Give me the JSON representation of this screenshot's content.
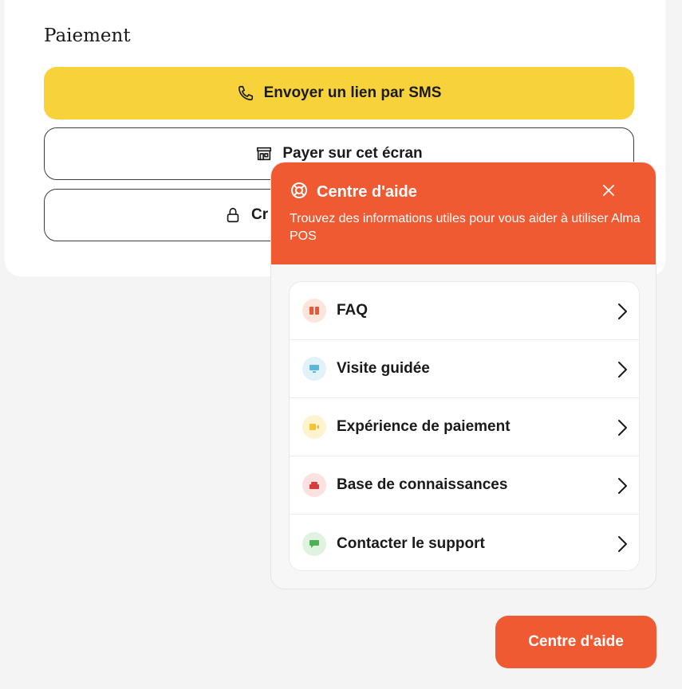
{
  "payment": {
    "title": "Paiement",
    "sms_button": "Envoyer un lien par SMS",
    "screen_button": "Payer sur cet écran",
    "create_button": "Cr"
  },
  "help_center": {
    "title": "Centre d'aide",
    "subtitle": "Trouvez des informations utiles pour vous aider à utiliser Alma POS",
    "items": [
      {
        "label": "FAQ",
        "icon": "book-icon",
        "icon_color": "#e8583a",
        "icon_bg": "#fde5dc"
      },
      {
        "label": "Visite guidée",
        "icon": "monitor-icon",
        "icon_color": "#5bb8d8",
        "icon_bg": "#e1f2f8"
      },
      {
        "label": "Expérience de paiement",
        "icon": "video-icon",
        "icon_color": "#f4c531",
        "icon_bg": "#fdf3cf"
      },
      {
        "label": "Base de connaissances",
        "icon": "box-icon",
        "icon_color": "#d83b3b",
        "icon_bg": "#fbe1e1"
      },
      {
        "label": "Contacter le support",
        "icon": "chat-icon",
        "icon_color": "#4fb153",
        "icon_bg": "#e0f2e0"
      }
    ]
  },
  "fab": {
    "label": "Centre d'aide"
  },
  "colors": {
    "accent": "#ef5a32",
    "sms_button_bg": "#f8d23a",
    "page_bg": "#f4f4f4"
  }
}
